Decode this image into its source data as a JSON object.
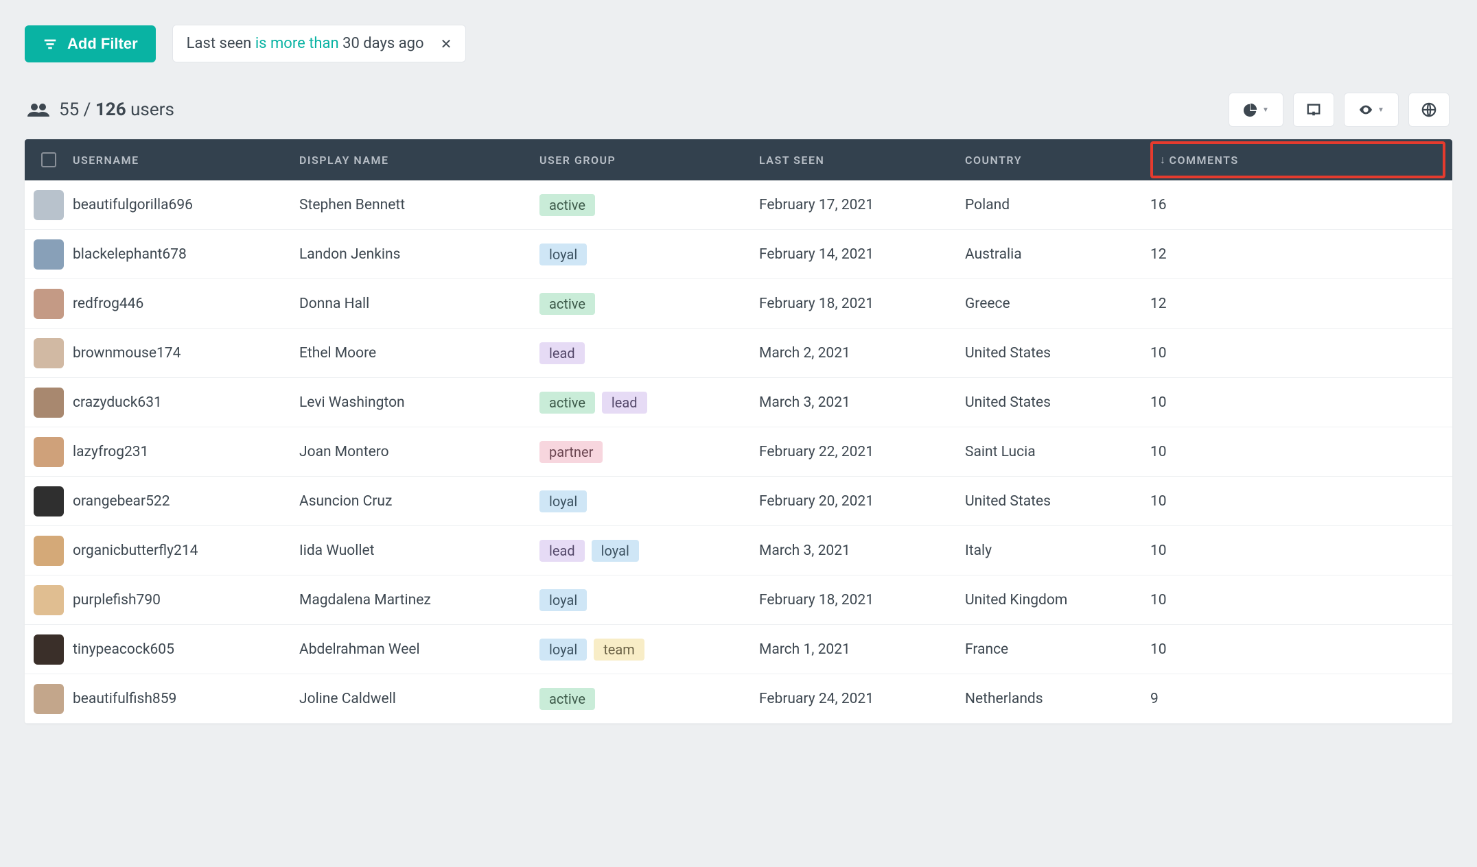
{
  "toolbar": {
    "add_filter_label": "Add Filter",
    "filter": {
      "field": "Last seen",
      "operator": "is more than",
      "value": "30 days ago"
    }
  },
  "summary": {
    "shown": "55",
    "sep": " / ",
    "total": "126",
    "suffix": " users"
  },
  "columns": {
    "username": "USERNAME",
    "display_name": "DISPLAY NAME",
    "user_group": "USER GROUP",
    "last_seen": "LAST SEEN",
    "country": "COUNTRY",
    "comments": "COMMENTS",
    "sort_indicator": "↓"
  },
  "avatar_colors": [
    "#b8c2cc",
    "#88a0b8",
    "#c49a85",
    "#d1b9a3",
    "#a8886f",
    "#cfa17a",
    "#2f2f2f",
    "#d4a978",
    "#e0be91",
    "#3a2f29",
    "#c3a68b"
  ],
  "rows": [
    {
      "username": "beautifulgorilla696",
      "display_name": "Stephen Bennett",
      "groups": [
        "active"
      ],
      "last_seen": "February 17, 2021",
      "country": "Poland",
      "comments": "16"
    },
    {
      "username": "blackelephant678",
      "display_name": "Landon Jenkins",
      "groups": [
        "loyal"
      ],
      "last_seen": "February 14, 2021",
      "country": "Australia",
      "comments": "12"
    },
    {
      "username": "redfrog446",
      "display_name": "Donna Hall",
      "groups": [
        "active"
      ],
      "last_seen": "February 18, 2021",
      "country": "Greece",
      "comments": "12"
    },
    {
      "username": "brownmouse174",
      "display_name": "Ethel Moore",
      "groups": [
        "lead"
      ],
      "last_seen": "March 2, 2021",
      "country": "United States",
      "comments": "10"
    },
    {
      "username": "crazyduck631",
      "display_name": "Levi Washington",
      "groups": [
        "active",
        "lead"
      ],
      "last_seen": "March 3, 2021",
      "country": "United States",
      "comments": "10"
    },
    {
      "username": "lazyfrog231",
      "display_name": "Joan Montero",
      "groups": [
        "partner"
      ],
      "last_seen": "February 22, 2021",
      "country": "Saint Lucia",
      "comments": "10"
    },
    {
      "username": "orangebear522",
      "display_name": "Asuncion Cruz",
      "groups": [
        "loyal"
      ],
      "last_seen": "February 20, 2021",
      "country": "United States",
      "comments": "10"
    },
    {
      "username": "organicbutterfly214",
      "display_name": "Iida Wuollet",
      "groups": [
        "lead",
        "loyal"
      ],
      "last_seen": "March 3, 2021",
      "country": "Italy",
      "comments": "10"
    },
    {
      "username": "purplefish790",
      "display_name": "Magdalena Martinez",
      "groups": [
        "loyal"
      ],
      "last_seen": "February 18, 2021",
      "country": "United Kingdom",
      "comments": "10"
    },
    {
      "username": "tinypeacock605",
      "display_name": "Abdelrahman Weel",
      "groups": [
        "loyal",
        "team"
      ],
      "last_seen": "March 1, 2021",
      "country": "France",
      "comments": "10"
    },
    {
      "username": "beautifulfish859",
      "display_name": "Joline Caldwell",
      "groups": [
        "active"
      ],
      "last_seen": "February 24, 2021",
      "country": "Netherlands",
      "comments": "9"
    }
  ]
}
